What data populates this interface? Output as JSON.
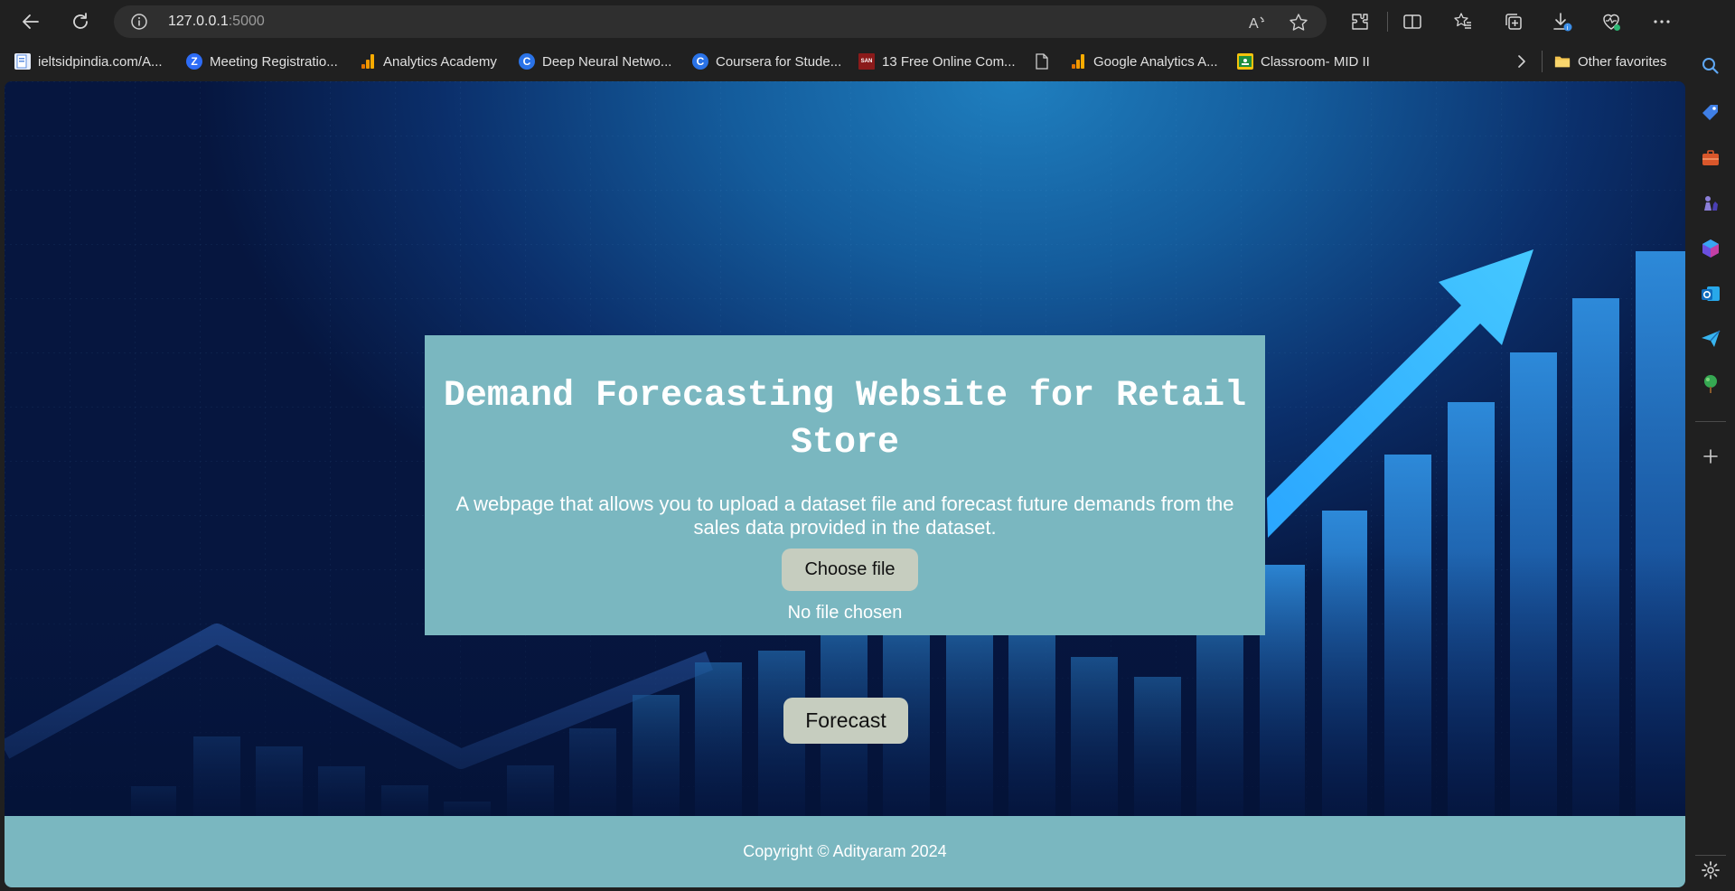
{
  "browser": {
    "url_host": "127.0.0.1",
    "url_port": ":5000",
    "bookmarks": [
      {
        "label": "ieltsidpindia.com/A...",
        "icon": "document-favicon-icon",
        "color": "#5b8de0"
      },
      {
        "label": "Meeting Registratio...",
        "icon": "zoom-favicon-icon",
        "color": "#2d6cf6"
      },
      {
        "label": "Analytics Academy",
        "icon": "analytics-favicon-icon",
        "color": "#f29900"
      },
      {
        "label": "Deep Neural Netwo...",
        "icon": "coursera-favicon-icon",
        "color": "#2a73e8"
      },
      {
        "label": "Coursera for Stude...",
        "icon": "coursera-favicon-icon",
        "color": "#2a73e8"
      },
      {
        "label": "13 Free Online Com...",
        "icon": "san-favicon-icon",
        "color": "#8b1a1a"
      },
      {
        "label": "",
        "icon": "page-favicon-icon",
        "color": "#cfcfcf"
      },
      {
        "label": "Google Analytics A...",
        "icon": "analytics-favicon-icon",
        "color": "#f29900"
      },
      {
        "label": "Classroom- MID II",
        "icon": "classroom-favicon-icon",
        "color": "#f4c20d"
      }
    ],
    "other_favorites": "Other favorites",
    "san_text": "SAN"
  },
  "page": {
    "title": "Demand Forecasting Website for Retail Store",
    "description": "A webpage that allows you to upload a dataset file and forecast future demands from the sales data provided in the dataset.",
    "choose_file_label": "Choose file",
    "no_file_label": "No file chosen",
    "forecast_label": "Forecast",
    "footer": "Copyright © Adityaram 2024",
    "colors": {
      "card": "#7ab7c0",
      "button": "#c6cdbf",
      "footer": "#7ab7c0"
    }
  }
}
